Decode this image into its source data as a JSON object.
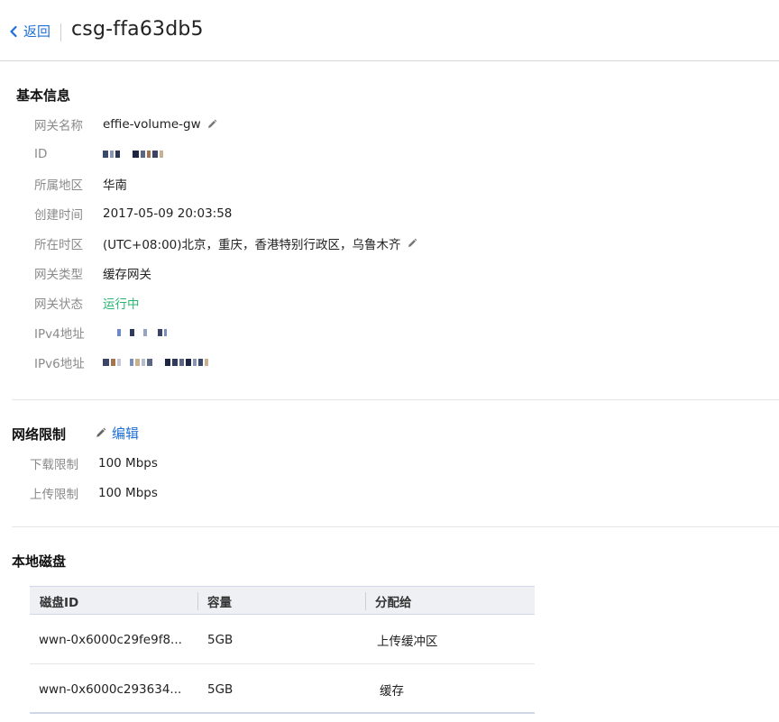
{
  "header": {
    "back_label": "返回",
    "title": "csg-ffa63db5"
  },
  "basic_info": {
    "title": "基本信息",
    "rows": [
      {
        "label": "网关名称",
        "value": "effie-volume-gw"
      },
      {
        "label": "ID",
        "value": ""
      },
      {
        "label": "所属地区",
        "value": "华南"
      },
      {
        "label": "创建时间",
        "value": "2017-05-09 20:03:58"
      },
      {
        "label": "所在时区",
        "value": "(UTC+08:00)北京，重庆，香港特别行政区，乌鲁木齐"
      },
      {
        "label": "网关类型",
        "value": "缓存网关"
      },
      {
        "label": "网关状态",
        "value": "运行中"
      },
      {
        "label": "IPv4地址",
        "value": ""
      },
      {
        "label": "IPv6地址",
        "value": ""
      }
    ]
  },
  "network_limit": {
    "title": "网络限制",
    "edit_label": "编辑",
    "rows": [
      {
        "label": "下载限制",
        "value": "100 Mbps"
      },
      {
        "label": "上传限制",
        "value": "100 Mbps"
      }
    ]
  },
  "local_disk": {
    "title": "本地磁盘",
    "columns": [
      "磁盘ID",
      "容量",
      "分配给"
    ],
    "rows": [
      {
        "id": "wwn-0x6000c29fe9f8...",
        "capacity": "5GB",
        "assigned": "上传缓冲区"
      },
      {
        "id": "wwn-0x6000c293634...",
        "capacity": "5GB",
        "assigned": "缓存"
      }
    ]
  },
  "colors": {
    "link": "#1f6fd8",
    "status_running": "#2bb673",
    "label": "#8a8a8a"
  },
  "icons": {
    "back": "chevron-left-icon",
    "edit": "pencil-icon"
  }
}
